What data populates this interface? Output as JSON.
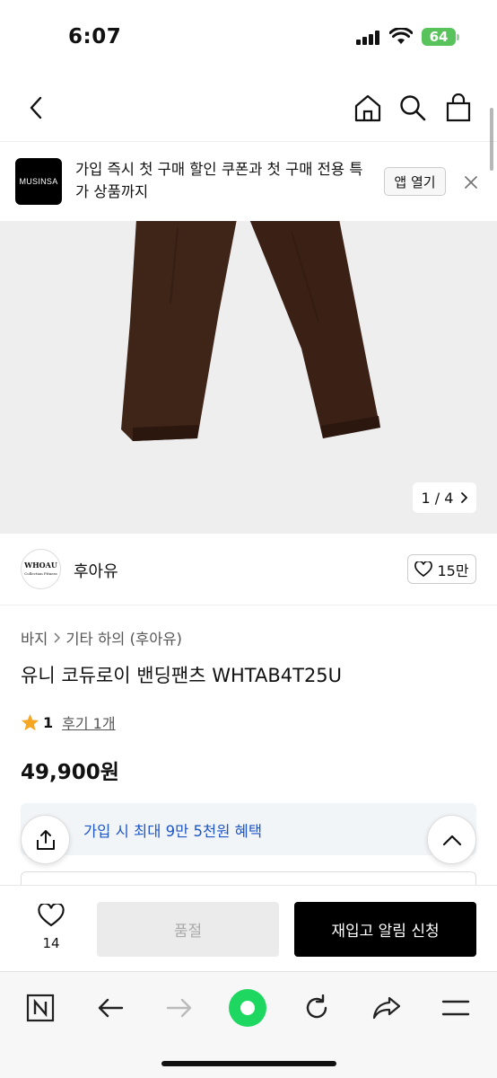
{
  "status_bar": {
    "time": "6:07",
    "battery": "64"
  },
  "app_banner": {
    "logo_text": "MUSINSA",
    "message": "가입 즉시 첫 구매 할인 쿠폰과 첫 구매 전용 특가 상품까지",
    "open_label": "앱 열기"
  },
  "gallery": {
    "counter": "1 / 4"
  },
  "brand": {
    "logo_text": "WHOAU",
    "logo_sub": "Collection Fitness",
    "name": "후아유",
    "likes": "15만"
  },
  "breadcrumb": [
    "바지",
    "기타 하의 (후아유)"
  ],
  "product": {
    "title": "유니 코듀로이 밴딩팬츠 WHTAB4T25U",
    "rating": "1",
    "review_link": "후기 1개",
    "price": "49,900원"
  },
  "benefit": {
    "text": "가입 시 최대 9만 5천원 혜택"
  },
  "purchase_bar": {
    "wish_count": "14",
    "soldout_label": "품절",
    "restock_label": "재입고 알림 신청"
  },
  "colors": {
    "accent_blue": "#1f56c5",
    "star": "#f5a623",
    "pants": "#3f2418",
    "browser_green": "#1ed760"
  }
}
